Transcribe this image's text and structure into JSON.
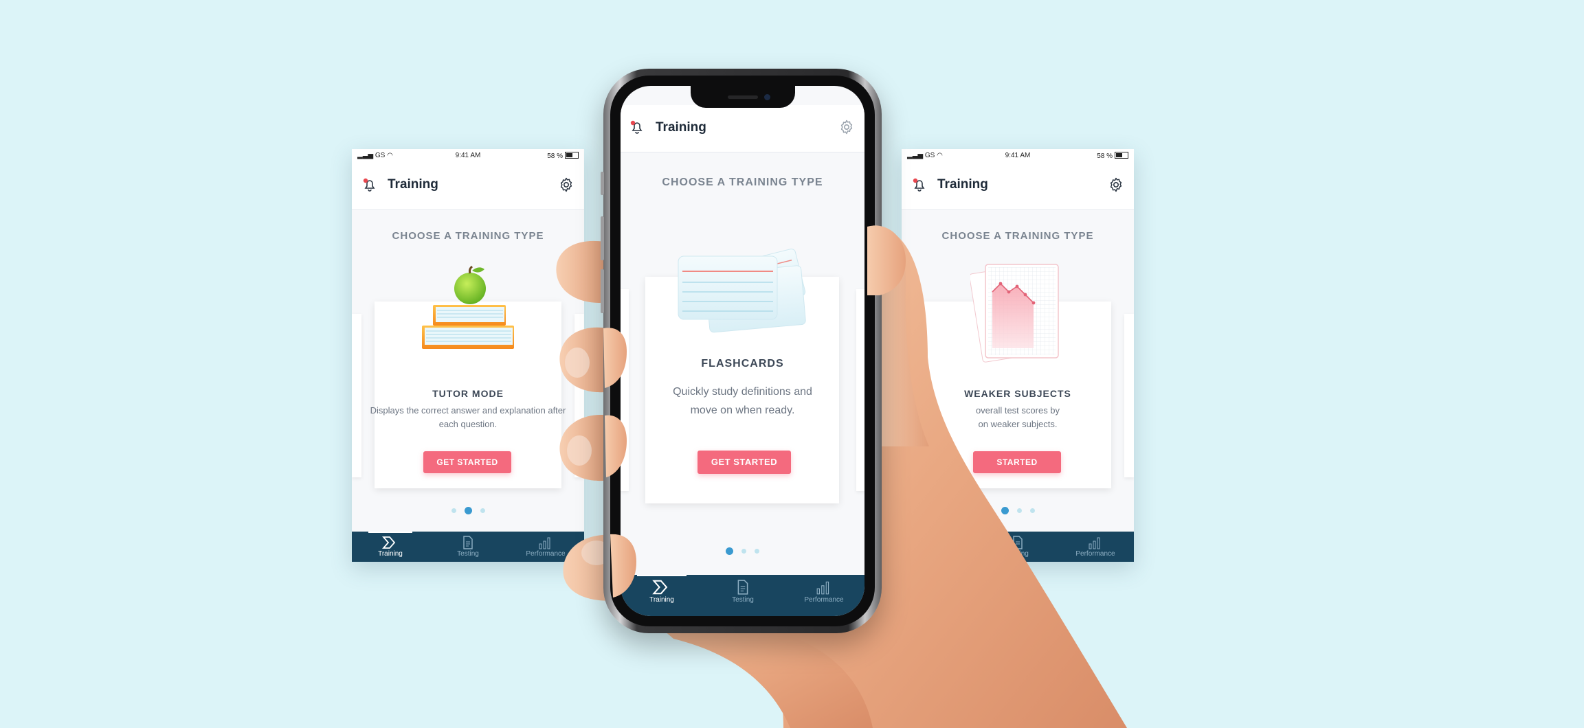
{
  "status_bar": {
    "carrier": "GS",
    "time": "9:41 AM",
    "battery": "58 %"
  },
  "app": {
    "title": "Training",
    "bell_icon": "bell-notification-icon",
    "settings_icon": "gear-icon"
  },
  "heading": "CHOOSE A TRAINING TYPE",
  "left_card": {
    "title": "TUTOR MODE",
    "desc": "Displays the correct answer and explanation after each question.",
    "button": "GET STARTED",
    "illustration": "books-with-apple"
  },
  "center_card": {
    "title": "FLASHCARDS",
    "desc": "Quickly study definitions and move on when ready.",
    "button": "GET STARTED",
    "illustration": "flashcards"
  },
  "right_card": {
    "title": "WEAKER SUBJECTS",
    "desc_line1": "overall test scores by",
    "desc_line2": "on weaker subjects.",
    "button": "STARTED",
    "illustration": "graph-paper-chart"
  },
  "pagination": {
    "count": 3,
    "left_active": 2,
    "center_active": 1,
    "right_active": 1
  },
  "tabs": [
    {
      "label": "Training",
      "icon": "training-chevron-icon",
      "active": true
    },
    {
      "label": "Testing",
      "icon": "document-icon",
      "active": false
    },
    {
      "label": "Performance",
      "icon": "bar-chart-icon",
      "active": false
    }
  ],
  "colors": {
    "accent": "#f46a7e",
    "tabbar": "#18455f",
    "dot_active": "#3a9ad0",
    "background": "#dcf4f8"
  }
}
